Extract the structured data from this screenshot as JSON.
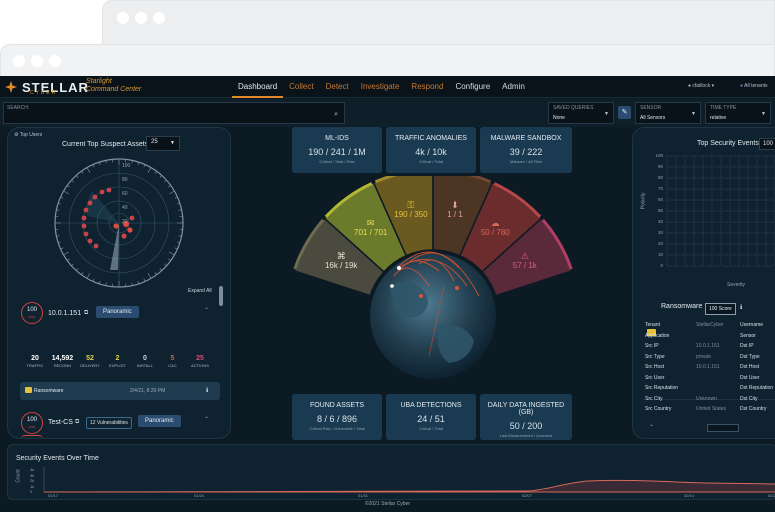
{
  "brand": {
    "name": "STELLAR",
    "sub": "CYBER",
    "product_line1": "Starlight",
    "product_line2": "Command Center"
  },
  "nav": {
    "items": [
      {
        "label": "Dashboard",
        "state": "active"
      },
      {
        "label": "Collect",
        "state": "orange"
      },
      {
        "label": "Detect",
        "state": "orange"
      },
      {
        "label": "Investigate",
        "state": "orange"
      },
      {
        "label": "Respond",
        "state": "orange"
      },
      {
        "label": "Configure",
        "state": "white"
      },
      {
        "label": "Admin",
        "state": "white"
      }
    ],
    "user": "cfaillock ▾",
    "tenant": "All tenants"
  },
  "filters": {
    "search_label": "SEARCH:",
    "saved_queries_label": "SAVED QUERIES",
    "saved_queries_value": "None",
    "sensor_label": "SENSOR",
    "sensor_value": "All Sensors",
    "time_type_label": "TIME TYPE",
    "time_type_value": "relative"
  },
  "left": {
    "top_users": "⚙ Top Users",
    "title": "Current Top Suspect Assets",
    "count": "25",
    "radar_ticks": [
      "100",
      "80",
      "60",
      "40",
      "20"
    ],
    "expand_all": "Expand All",
    "asset1": {
      "risk": "100",
      "risk_label": "RISK",
      "ip": "10.0.1.151",
      "button": "Panoramic",
      "stats": [
        {
          "value": "20",
          "label": "TRAFFIC",
          "color": "#ffffff"
        },
        {
          "value": "14,592",
          "label": "RECONN",
          "color": "#ffffff"
        },
        {
          "value": "52",
          "label": "DELIVERY",
          "color": "#e4d04a"
        },
        {
          "value": "2",
          "label": "EXPLOIT",
          "color": "#e4d04a"
        },
        {
          "value": "0",
          "label": "INSTALL",
          "color": "#c9d4dc"
        },
        {
          "value": "5",
          "label": "C&C",
          "color": "#e15a3c"
        },
        {
          "value": "25",
          "label": "ACTIONS",
          "color": "#d94a7a"
        }
      ],
      "alert_name": "Ransomware",
      "alert_time": "2/4/21, 8:20 PM",
      "alert_info": "ℹ"
    },
    "asset2": {
      "risk": "100",
      "risk_label": "RISK",
      "name": "Test-CS",
      "vulns": "12 Vulnerabilities",
      "button": "Panoramic"
    }
  },
  "cards_top": [
    {
      "title": "ML-IDS",
      "value": "190 / 241 / 1M",
      "sub": "Critical / Total / Raw"
    },
    {
      "title": "TRAFFIC ANOMALIES",
      "value": "4k / 10k",
      "sub": "Critical / Total"
    },
    {
      "title": "MALWARE SANDBOX",
      "value": "39 / 222",
      "sub": "Malware / All Files"
    }
  ],
  "cards_bottom": [
    {
      "title": "FOUND ASSETS",
      "value": "8 / 6 / 896",
      "sub": "Critical Risk / Vulnerable / Total"
    },
    {
      "title": "UBA DETECTIONS",
      "value": "24 / 51",
      "sub": "Critical / Total"
    },
    {
      "title": "DAILY DATA INGESTED (GB)",
      "value": "50 / 200",
      "sub": "Last Measurement / Licensed"
    }
  ],
  "arc_segments": [
    {
      "value": "16k / 19k",
      "icon": "binoculars-icon"
    },
    {
      "value": "701 / 701",
      "icon": "envelope-icon"
    },
    {
      "value": "190 / 350",
      "icon": "key-icon"
    },
    {
      "value": "1 / 1",
      "icon": "download-icon"
    },
    {
      "value": "50 / 780",
      "icon": "cloud-icon"
    },
    {
      "value": "57 / 1k",
      "icon": "alert-icon"
    }
  ],
  "right": {
    "title": "Top Security Events",
    "select": "100",
    "y_ticks": [
      "100",
      "90",
      "80",
      "70",
      "60",
      "50",
      "40",
      "30",
      "20",
      "10",
      "0"
    ],
    "y_label": "Polarity",
    "x_label": "Severity",
    "ransom_title": "Ransomware",
    "score": "100 Score",
    "info": "ℹ",
    "rows": [
      {
        "label": "Tenant",
        "value": "StellarCyber",
        "label2": "Username"
      },
      {
        "label": "Application",
        "value": "",
        "label2": "Sensor"
      },
      {
        "label": "Src IP",
        "value": "10.0.1.151",
        "label2": "Dst IP"
      },
      {
        "label": "Src Type",
        "value": "private",
        "label2": "Dst Type"
      },
      {
        "label": "Src Host",
        "value": "10.0.1.151",
        "label2": "Dst Host"
      },
      {
        "label": "Src User",
        "value": "",
        "label2": "Dst User"
      },
      {
        "label": "Src Reputation",
        "value": "",
        "label2": "Dst Reputation"
      },
      {
        "label": "Src City",
        "value": "Unknown",
        "label2": "Dst City"
      },
      {
        "label": "Src Country",
        "value": "United States",
        "label2": "Dst Country"
      }
    ]
  },
  "bottom": {
    "title": "Security Events Over Time",
    "y_ticks": [
      "4k",
      "3k",
      "2k",
      "1k",
      "0"
    ],
    "y_label": "Count",
    "x_ticks": [
      "01/17",
      "01/24",
      "01/31",
      "02/07",
      "02/14",
      "02/21"
    ]
  },
  "footer": "©2021 Stellar Cyber"
}
